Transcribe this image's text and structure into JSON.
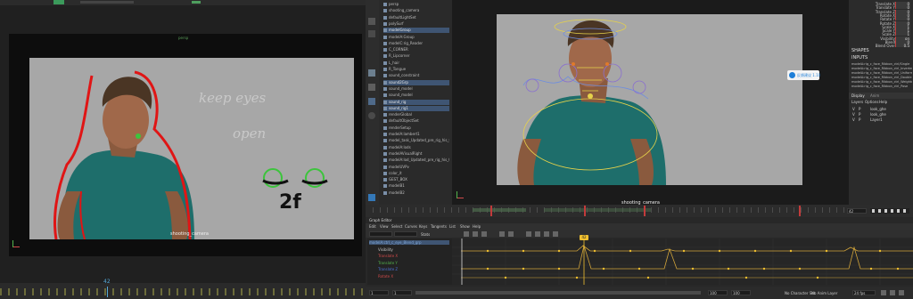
{
  "left_viewport": {
    "camera_label": "shooting_camera",
    "top_label": "persp",
    "annotation_text_1": "keep eyes",
    "annotation_text_2": "open",
    "annotation_frames": "2f",
    "current_frame": "42"
  },
  "outliner": {
    "items": [
      {
        "label": "persp",
        "selected": false
      },
      {
        "label": "shooting_camera",
        "selected": false
      },
      {
        "label": "defaultLightSet",
        "selected": false
      },
      {
        "label": "polySurf",
        "selected": false
      },
      {
        "label": "modelGroup",
        "selected": true
      },
      {
        "label": "modelA:Group",
        "selected": false
      },
      {
        "label": "modelC:rig_Reader",
        "selected": false
      },
      {
        "label": "C_CORNER",
        "selected": false
      },
      {
        "label": "R_Lipcorner",
        "selected": false
      },
      {
        "label": "L_hair",
        "selected": false
      },
      {
        "label": "R_Tongue",
        "selected": false
      },
      {
        "label": "sound_constraint",
        "selected": false
      },
      {
        "label": "sound2Grp",
        "selected": true
      },
      {
        "label": "sound_model",
        "selected": false
      },
      {
        "label": "sound_model",
        "selected": false
      },
      {
        "label": "sound_rig",
        "selected": true
      },
      {
        "label": "sound_rig1",
        "selected": true
      },
      {
        "label": "renderGlobal",
        "selected": false
      },
      {
        "label": "defaultObjectSet",
        "selected": false
      },
      {
        "label": "renderSetup",
        "selected": false
      },
      {
        "label": "modelA:lambert1",
        "selected": false
      },
      {
        "label": "model_task_Updated_pre_rig_his_05",
        "selected": false
      },
      {
        "label": "modelA:lods",
        "selected": false
      },
      {
        "label": "modelAVisualRight",
        "selected": false
      },
      {
        "label": "modelA:lod_Updated_pre_rig_his_05",
        "selected": false
      },
      {
        "label": "modelUVPv",
        "selected": false
      },
      {
        "label": "color_it",
        "selected": false
      },
      {
        "label": "GEST_BOX",
        "selected": false
      },
      {
        "label": "modelB1",
        "selected": false
      },
      {
        "label": "modelB2",
        "selected": false
      }
    ]
  },
  "right_viewport": {
    "camera_label": "shooting_camera",
    "badge_label": "反馈建议 1.10"
  },
  "channel_box": {
    "channels": [
      {
        "label": "Translate X",
        "value": "0"
      },
      {
        "label": "Translate Y",
        "value": "0"
      },
      {
        "label": "Translate Z",
        "value": "0"
      },
      {
        "label": "Rotate X",
        "value": "0"
      },
      {
        "label": "Rotate Y",
        "value": "0"
      },
      {
        "label": "Rotate Z",
        "value": "0"
      },
      {
        "label": "Scale X",
        "value": "1"
      },
      {
        "label": "Scale Y",
        "value": "1"
      },
      {
        "label": "Scale Z",
        "value": "1"
      },
      {
        "label": "Visibility",
        "value": "on"
      },
      {
        "label": "Blend",
        "value": "0"
      },
      {
        "label": "Blend Over",
        "value": "0.5"
      }
    ],
    "shapes_header": "SHAPES",
    "inputs_header": "INPUTS",
    "inputs": [
      "modelA:rig_c_face_Ribbon_ctrl/Single",
      "modelA:rig_c_face_Ribbon_ctrl_Inverted",
      "modelA:rig_c_face_Ribbon_ctrl_Uniform",
      "modelA:rig_c_face_Ribbon_ctrl_Double",
      "modelA:rig_c_face_Ribbon_ctrl_Weighted",
      "modelA:rig_c_face_Ribbon_ctrl_Pose"
    ],
    "layer_tabs": [
      "Display",
      "Anim"
    ],
    "layer_menu": [
      "Layers",
      "Options",
      "Help"
    ],
    "layers": [
      {
        "vis": "V",
        "play": "P",
        "name": "look_ghe"
      },
      {
        "vis": "V",
        "play": "P",
        "name": "look_ghe"
      },
      {
        "vis": "V",
        "play": "P",
        "name": "Layer1"
      }
    ]
  },
  "time_slider": {
    "start": "1",
    "end": "100",
    "current": "42",
    "range_end": "100"
  },
  "graph_editor": {
    "title": "Graph Editor",
    "menu": [
      "Edit",
      "View",
      "Select",
      "Curves",
      "Keys",
      "Tangents",
      "List",
      "Show",
      "Help"
    ],
    "stats_field": "",
    "show_label": "Stats",
    "list_items": [
      {
        "label": "modelA:ctrl_c_eye_Blend_grp",
        "color": "#7fa7d9",
        "selected": true
      },
      {
        "label": "Visibility",
        "color": "#c8c8c8",
        "selected": false
      },
      {
        "label": "Translate X",
        "color": "#d04a4a",
        "selected": false
      },
      {
        "label": "Translate Y",
        "color": "#53b34c",
        "selected": false
      },
      {
        "label": "Translate Z",
        "color": "#4b6fd0",
        "selected": false
      },
      {
        "label": "Rotate X",
        "color": "#d04a4a",
        "selected": false
      }
    ],
    "key_frame_marker": "42"
  },
  "status_bar": {
    "frame_start": "1",
    "frame_start2": "1",
    "range_end": "100",
    "range_end2": "100",
    "fps_label": "No Character Set",
    "anim_layer_label": "No Anim Layer",
    "fps_value": "24 fps"
  },
  "colors": {
    "accent_blue": "#4a6fa5",
    "keyframe_yellow": "#f0c030",
    "annotation_red": "#e01515",
    "annotation_green": "#3cc43c",
    "teal_shirt": "#1b6d6b"
  }
}
